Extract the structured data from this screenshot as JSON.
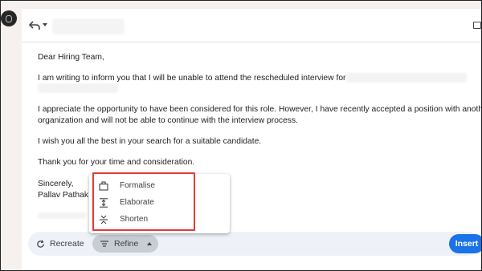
{
  "email": {
    "greeting": "Dear Hiring Team,",
    "line1": "I am writing to inform you that I will be unable to attend the rescheduled interview for the",
    "para2_line1": "I appreciate the opportunity to have been considered for this role. However, I have recently accepted a position with another",
    "para2_line2": "organization and will not be able to continue with the interview process.",
    "para3": "I wish you all the best in your search for a suitable candidate.",
    "para4": "Thank you for your time and consideration.",
    "closing": "Sincerely,",
    "signature": "Pallav Pathak"
  },
  "toolbar": {
    "recreate_label": "Recreate",
    "refine_label": "Refine",
    "insert_label": "Insert"
  },
  "refine_menu": {
    "items": [
      {
        "label": "Formalise",
        "icon": "briefcase-icon"
      },
      {
        "label": "Elaborate",
        "icon": "expand-vertical-icon"
      },
      {
        "label": "Shorten",
        "icon": "shorten-icon"
      }
    ]
  },
  "colors": {
    "accent": "#1a73e8",
    "highlight_border": "#e53935",
    "bar_background": "#eef2f8",
    "chip_background": "#c8cdd4"
  }
}
